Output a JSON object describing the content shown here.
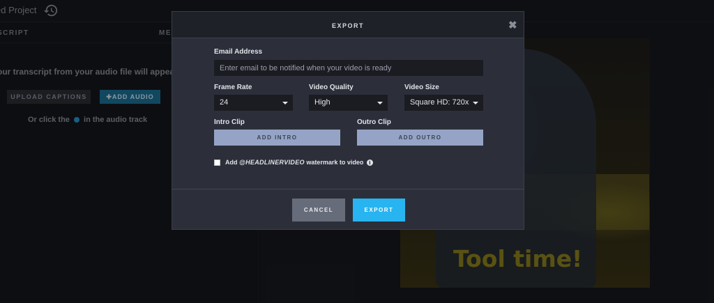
{
  "app": {
    "project_title": "ed Project",
    "history_icon": "history-icon"
  },
  "left_panel": {
    "tab_transcript": "SCRIPT",
    "tab_media": "ME",
    "transcript_message": "our transcript from your audio file will appear here",
    "upload_captions_label": "UPLOAD CAPTIONS",
    "add_audio_label": "✚ADD AUDIO",
    "or_click_prefix": "Or click the",
    "or_click_suffix": "in the audio track"
  },
  "preview": {
    "caption": "Tool time!"
  },
  "modal": {
    "title": "EXPORT",
    "close_glyph": "✖",
    "email_label": "Email Address",
    "email_placeholder": "Enter email to be notified when your video is ready",
    "email_value": "",
    "frame_rate_label": "Frame Rate",
    "frame_rate_value": "24",
    "video_quality_label": "Video Quality",
    "video_quality_value": "High",
    "video_size_label": "Video Size",
    "video_size_value": "Square HD: 720x",
    "intro_label": "Intro Clip",
    "intro_button": "ADD INTRO",
    "outro_label": "Outro Clip",
    "outro_button": "ADD OUTRO",
    "watermark_prefix": "Add",
    "watermark_brand": "@HEADLINERVIDEO",
    "watermark_suffix": "watermark to video",
    "watermark_checked": false,
    "info_glyph": "i",
    "cancel_label": "CANCEL",
    "export_label": "EXPORT"
  },
  "colors": {
    "accent": "#28b4f0",
    "clip_button": "#95a4c6",
    "cancel_button": "#666c7a",
    "modal_bg": "#2c2f3a"
  }
}
